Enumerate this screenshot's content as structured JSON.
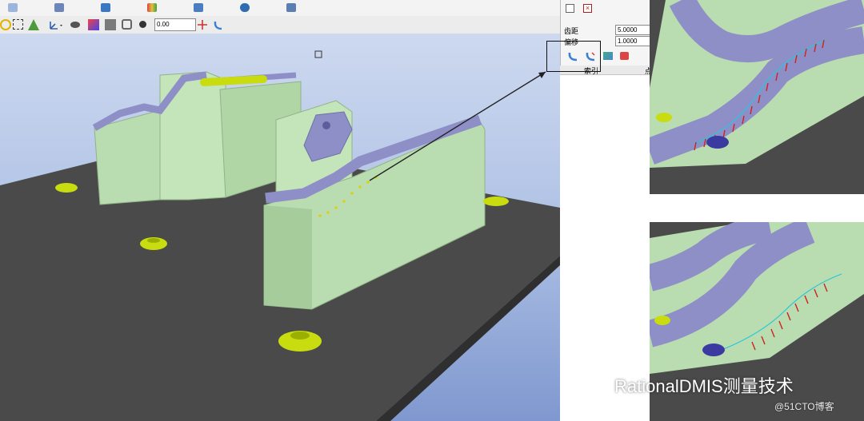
{
  "toolbar": {
    "offset_value": "0.00"
  },
  "panel": {
    "tooth_pitch_label": "齿距",
    "tooth_pitch_value": "5.0000",
    "offset_label": "偏移",
    "offset_value": "1.0000",
    "grid_header_index": "索引",
    "grid_header_partial": "点"
  },
  "watermark": {
    "title": "RationalDMIS测量技术",
    "sub": "@51CTO博客"
  },
  "colors": {
    "sky_top": "#cdd9ef",
    "sky_bottom": "#7f98cf",
    "plate": "#4a4a4a",
    "body_green": "#b9dcb0",
    "flange_purple": "#8f8fc8",
    "pin_yellow": "#c8dc10",
    "vector_red": "#cc2222",
    "highlight_cyan": "#26c6da"
  },
  "icons": [
    "new-icon",
    "table-icon",
    "probe-icon",
    "color-icon",
    "shield-icon",
    "link-icon",
    "report-icon",
    "check-icon",
    "close-icon"
  ]
}
